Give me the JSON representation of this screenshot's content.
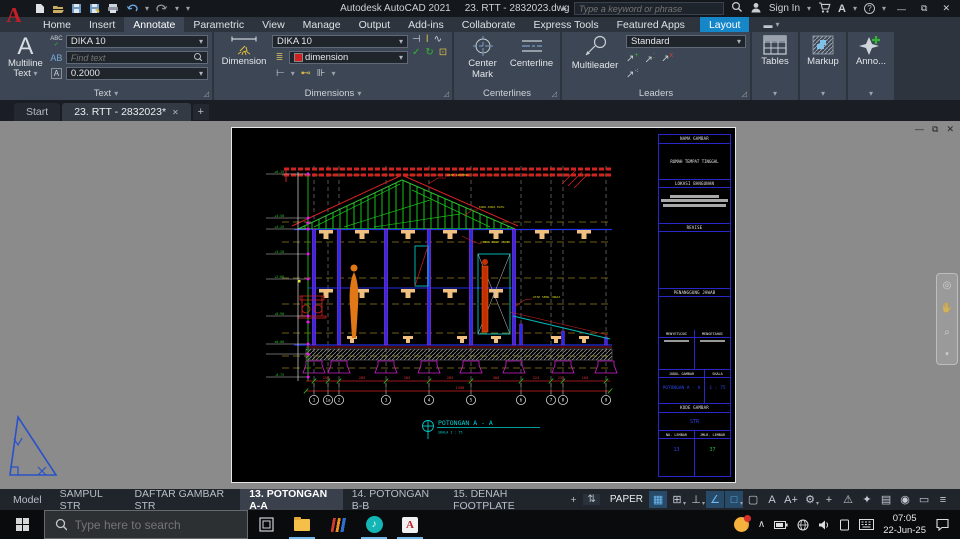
{
  "titlebar": {
    "app_title": "Autodesk AutoCAD 2021",
    "doc_title": "23. RTT - 2832023.dwg",
    "search_placeholder": "Type a keyword or phrase",
    "sign_in_label": "Sign In"
  },
  "ribbon": {
    "tabs": [
      {
        "label": "Home"
      },
      {
        "label": "Insert"
      },
      {
        "label": "Annotate"
      },
      {
        "label": "Parametric"
      },
      {
        "label": "View"
      },
      {
        "label": "Manage"
      },
      {
        "label": "Output"
      },
      {
        "label": "Add-ins"
      },
      {
        "label": "Collaborate"
      },
      {
        "label": "Express Tools"
      },
      {
        "label": "Featured Apps"
      },
      {
        "label": "Layout"
      }
    ],
    "text_panel": {
      "label": "Text",
      "button_line1": "Multiline",
      "button_line2": "Text",
      "style_value": "DIKA 10",
      "find_placeholder": "Find text",
      "height_value": "0.2000"
    },
    "dim_panel": {
      "label": "Dimensions",
      "button": "Dimension",
      "style_value": "DIKA 10",
      "layer_value": "dimension"
    },
    "center_panel": {
      "label": "Centerlines",
      "center_mark_line1": "Center",
      "center_mark_line2": "Mark",
      "centerline": "Centerline"
    },
    "leader_panel": {
      "label": "Leaders",
      "button": "Multileader",
      "style_value": "Standard"
    },
    "tables_panel": {
      "button": "Tables"
    },
    "markup_panel": {
      "button": "Markup"
    },
    "anno_panel": {
      "button": "Anno..."
    }
  },
  "file_tabs": [
    {
      "label": "Start"
    },
    {
      "label": "23. RTT - 2832023*"
    }
  ],
  "drawing": {
    "section_title": "POTONGAN A - A",
    "section_scale": "SKALA 1 : 75",
    "grid_bubbles": [
      "1",
      "1a",
      "2",
      "3",
      "4",
      "5",
      "6",
      "7",
      "8",
      "9"
    ],
    "dim_values": [
      "156",
      "285",
      "285",
      "285",
      "300",
      "224",
      "251",
      "105"
    ],
    "total_dim": "1590",
    "elevations": [
      "+6.15",
      "+4.50",
      "+4.20",
      "+3.20",
      "+2.60",
      "+0.90",
      "±0.00",
      "-0.75"
    ],
    "annotations": [
      "ATAP GENTENG",
      "KUDA-KUDA KAYU",
      "RING BALK 15/20",
      "ATAP SENG JURAI"
    ],
    "title_block": {
      "nama_gambar_label": "NAMA GAMBAR",
      "nama_gambar_value": "RUMAH TEMPAT TINGGAL",
      "lokasi_label": "LOKASI BANGUNAN",
      "revise_label": "REVISE",
      "penanggung_label": "PENANGGUNG JAWAB",
      "menyetujui_label": "MENYETUJUI",
      "mengetahui_label": "MENGETAHUI",
      "judul_label": "JUDUL GAMBAR",
      "skala_label": "SKALA",
      "judul_value": "POTONGAN A - A",
      "skala_value": "1 : 75",
      "kode_label": "KODE GAMBAR",
      "kode_value": "STR",
      "no_lembar_label": "NO. LEMBAR",
      "jml_lembar_label": "JMLH. LEMBAR",
      "no_lembar_value": "13",
      "jml_lembar_value": "37"
    }
  },
  "layout_tabs": [
    {
      "label": "Model"
    },
    {
      "label": "SAMPUL STR"
    },
    {
      "label": "DAFTAR GAMBAR STR"
    },
    {
      "label": "13. POTONGAN A-A"
    },
    {
      "label": "14. POTONGAN B-B"
    },
    {
      "label": "15. DENAH FOOTPLATE"
    }
  ],
  "status_bar": {
    "space_label": "PAPER"
  },
  "taskbar": {
    "search_placeholder": "Type here to search",
    "time": "07:05",
    "date": "22-Jun-25"
  },
  "icons": {
    "grid": "▦",
    "snap": "⊞",
    "ortho": "⊥",
    "polar": "∠",
    "osnap": "□",
    "isodraft": "▢",
    "annot_vis": "A",
    "annot_scale": "A+",
    "gear": "⚙",
    "crosshair": "+",
    "monitor": "⚠",
    "workspace": "✦",
    "quickprops": "▤",
    "isolate": "◉",
    "display": "▭",
    "menu": "≡",
    "overflow": "⇅",
    "chev_down": "▾",
    "chev_right": "▸",
    "chev_up": "∧",
    "launcher": "◿",
    "spell": "ABC",
    "spell_check": "✓",
    "layers": "≣",
    "boxed_a": "A",
    "align_ab": "AB",
    "close": "✕",
    "minimize": "—",
    "restore": "⧉",
    "plus": "+",
    "note": "♪",
    "panel_toggle": "▬",
    "question": "?"
  },
  "colors": {
    "accent_blue": "#1586c8",
    "cad_green": "#19c219",
    "cad_red": "#d22222",
    "cad_cyan": "#00c8c8",
    "cad_magenta": "#d020d0",
    "cad_tan": "#f0c080",
    "cad_yellow": "#d8d820"
  }
}
